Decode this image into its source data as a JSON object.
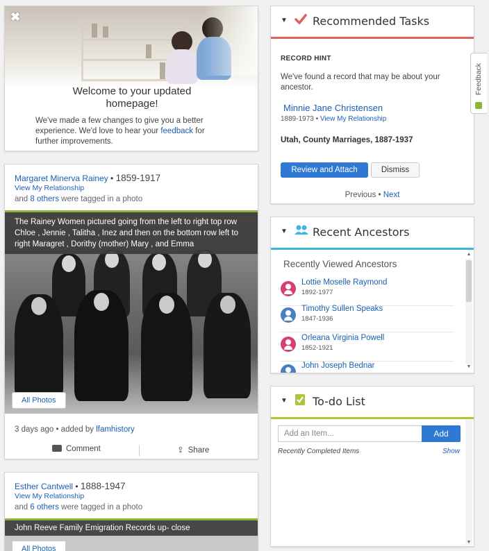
{
  "welcome": {
    "close_icon": "close-icon",
    "title": "Welcome to your updated homepage!",
    "text_before": "We've made a few changes to give you a better experience. We'd love to hear your ",
    "link": "feedback",
    "text_after": " for further improvements."
  },
  "photo1": {
    "name": "Margaret Minerva Rainey",
    "sep": " • ",
    "years": "1859-1917",
    "relationship": "View My Relationship",
    "tagged_pre": "and ",
    "tagged_link": "8 others",
    "tagged_post": " were tagged in a photo",
    "caption": "The Rainey Women pictured going from the left to right top row Chloe , Jennie , Talitha , Inez and then on the bottom row left to right Maragret , Dorithy (mother) Mary , and Emma",
    "all_photos": "All Photos",
    "meta_pre": "3 days ago • added by ",
    "meta_link": "lfamhistory",
    "comment": "Comment",
    "share": "Share"
  },
  "photo2": {
    "name": "Esther Cantwell",
    "sep": " • ",
    "years": "1888-1947",
    "relationship": "View My Relationship",
    "tagged_pre": "and ",
    "tagged_link": "6 others",
    "tagged_post": " were tagged in a photo",
    "caption": "John Reeve Family Emigration Records up- close",
    "all_photos": "All Photos"
  },
  "tasks": {
    "title": "Recommended Tasks",
    "icon": "checkmark-icon",
    "hint_label": "RECORD HINT",
    "hint_text": "We've found a record that may be about your ancestor.",
    "person_name": "Minnie Jane Christensen",
    "person_years": "1889-1973 • ",
    "relationship": "View My Relationship",
    "record": "Utah, County Marriages, 1887-1937",
    "primary_button": "Review and Attach",
    "secondary_button": "Dismiss",
    "previous": "Previous",
    "pager_sep": " • ",
    "next": "Next"
  },
  "feedback_tab": {
    "label": "Feedback"
  },
  "ancestors": {
    "title": "Recent Ancestors",
    "subtitle": "Recently Viewed Ancestors",
    "items": [
      {
        "name": "Lottie Moselle Raymond",
        "years": "1892-1977",
        "gender": "female"
      },
      {
        "name": "Timothy Sullen Speaks",
        "years": "1847-1936",
        "gender": "male"
      },
      {
        "name": "Orleana Virginia Powell",
        "years": "1852-1921",
        "gender": "female"
      },
      {
        "name": "John Joseph Bednar",
        "years": "",
        "gender": "male"
      }
    ]
  },
  "todo": {
    "title": "To-do List",
    "placeholder": "Add an Item...",
    "add_button": "Add",
    "completed_label": "Recently Completed Items",
    "show_link": "Show"
  },
  "colors": {
    "link": "#1a5fb4",
    "button": "#2f78d4",
    "tasks_rule": "#e25d5d",
    "ancestors_rule": "#3bb6e6",
    "todo_rule": "#a7c93d",
    "female": "#d63f78",
    "male": "#4a7fc1"
  }
}
